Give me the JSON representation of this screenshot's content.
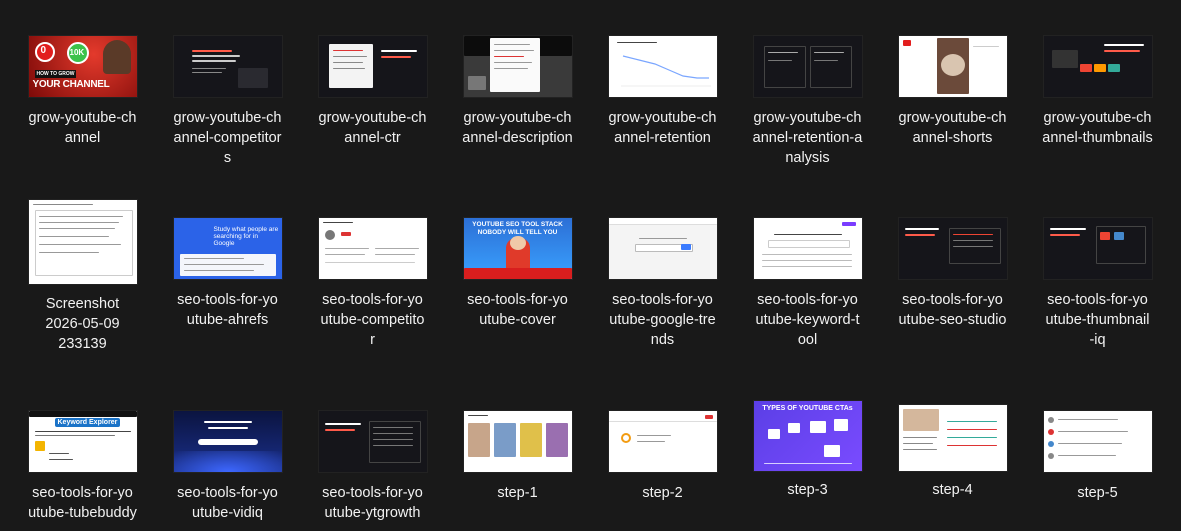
{
  "files": [
    {
      "name": "grow-youtube-channel",
      "lines": [
        "grow-youtube-ch",
        "annel"
      ],
      "thumb": "red",
      "thumb_text": {
        "n0": "0",
        "n10k": "10K",
        "how": "HOW TO GROW",
        "channel": "YOUR CHANNEL"
      }
    },
    {
      "name": "grow-youtube-channel-competitors",
      "lines": [
        "grow-youtube-ch",
        "annel-competitor",
        "s"
      ],
      "thumb": "dark"
    },
    {
      "name": "grow-youtube-channel-ctr",
      "lines": [
        "grow-youtube-ch",
        "annel-ctr"
      ],
      "thumb": "dark-card"
    },
    {
      "name": "grow-youtube-channel-description",
      "lines": [
        "grow-youtube-ch",
        "annel-description"
      ],
      "thumb": "dark-modal"
    },
    {
      "name": "grow-youtube-channel-retention",
      "lines": [
        "grow-youtube-ch",
        "annel-retention"
      ],
      "thumb": "white-chart"
    },
    {
      "name": "grow-youtube-channel-retention-analysis",
      "lines": [
        "grow-youtube-ch",
        "annel-retention-a",
        "nalysis"
      ],
      "thumb": "dark-cols"
    },
    {
      "name": "grow-youtube-channel-shorts",
      "lines": [
        "grow-youtube-ch",
        "annel-shorts"
      ],
      "thumb": "white-shorts"
    },
    {
      "name": "grow-youtube-channel-thumbnails",
      "lines": [
        "grow-youtube-ch",
        "annel-thumbnails"
      ],
      "thumb": "dark-thumbs"
    },
    {
      "name": "Screenshot 2026-05-09 233139",
      "lines": [
        "Screenshot",
        "2026-05-09",
        "233139"
      ],
      "thumb": "white-doc"
    },
    {
      "name": "seo-tools-for-youtube-ahrefs",
      "lines": [
        "seo-tools-for-yo",
        "utube-ahrefs"
      ],
      "thumb": "blue-ahrefs",
      "thumb_text": {
        "head": "Study what people are searching for in Google"
      }
    },
    {
      "name": "seo-tools-for-youtube-competitor",
      "lines": [
        "seo-tools-for-yo",
        "utube-competito",
        "r"
      ],
      "thumb": "white-comp"
    },
    {
      "name": "seo-tools-for-youtube-cover",
      "lines": [
        "seo-tools-for-yo",
        "utube-cover"
      ],
      "thumb": "cover",
      "thumb_text": {
        "head": "YOUTUBE SEO TOOL STACK NOBODY WILL TELL YOU"
      }
    },
    {
      "name": "seo-tools-for-youtube-google-trends",
      "lines": [
        "seo-tools-for-yo",
        "utube-google-tre",
        "nds"
      ],
      "thumb": "white-trends"
    },
    {
      "name": "seo-tools-for-youtube-keyword-tool",
      "lines": [
        "seo-tools-for-yo",
        "utube-keyword-t",
        "ool"
      ],
      "thumb": "white-kw"
    },
    {
      "name": "seo-tools-for-youtube-seo-studio",
      "lines": [
        "seo-tools-for-yo",
        "utube-seo-studio"
      ],
      "thumb": "dark-studio"
    },
    {
      "name": "seo-tools-for-youtube-thumbnail-iq",
      "lines": [
        "seo-tools-for-yo",
        "utube-thumbnail",
        "-iq"
      ],
      "thumb": "dark-iq"
    },
    {
      "name": "seo-tools-for-youtube-tubebuddy",
      "lines": [
        "seo-tools-for-yo",
        "utube-tubebuddy"
      ],
      "thumb": "tubebuddy",
      "thumb_text": {
        "badge": "Keyword Explorer"
      }
    },
    {
      "name": "seo-tools-for-youtube-vidiq",
      "lines": [
        "seo-tools-for-yo",
        "utube-vidiq"
      ],
      "thumb": "vidiq"
    },
    {
      "name": "seo-tools-for-youtube-ytgrowth",
      "lines": [
        "seo-tools-for-yo",
        "utube-ytgrowth"
      ],
      "thumb": "dark-yt"
    },
    {
      "name": "step-1",
      "lines": [
        "step-1"
      ],
      "thumb": "white-step1"
    },
    {
      "name": "step-2",
      "lines": [
        "step-2"
      ],
      "thumb": "white-step2"
    },
    {
      "name": "step-3",
      "lines": [
        "step-3"
      ],
      "thumb": "purple-cta",
      "thumb_text": {
        "head": "TYPES OF YOUTUBE CTAs"
      }
    },
    {
      "name": "step-4",
      "lines": [
        "step-4"
      ],
      "thumb": "white-step4"
    },
    {
      "name": "step-5",
      "lines": [
        "step-5"
      ],
      "thumb": "white-step5"
    }
  ],
  "colors": {
    "background": "#191919",
    "label": "#f2f2f2",
    "accent_red": "#d81e1e",
    "accent_green": "#3cc24b"
  }
}
